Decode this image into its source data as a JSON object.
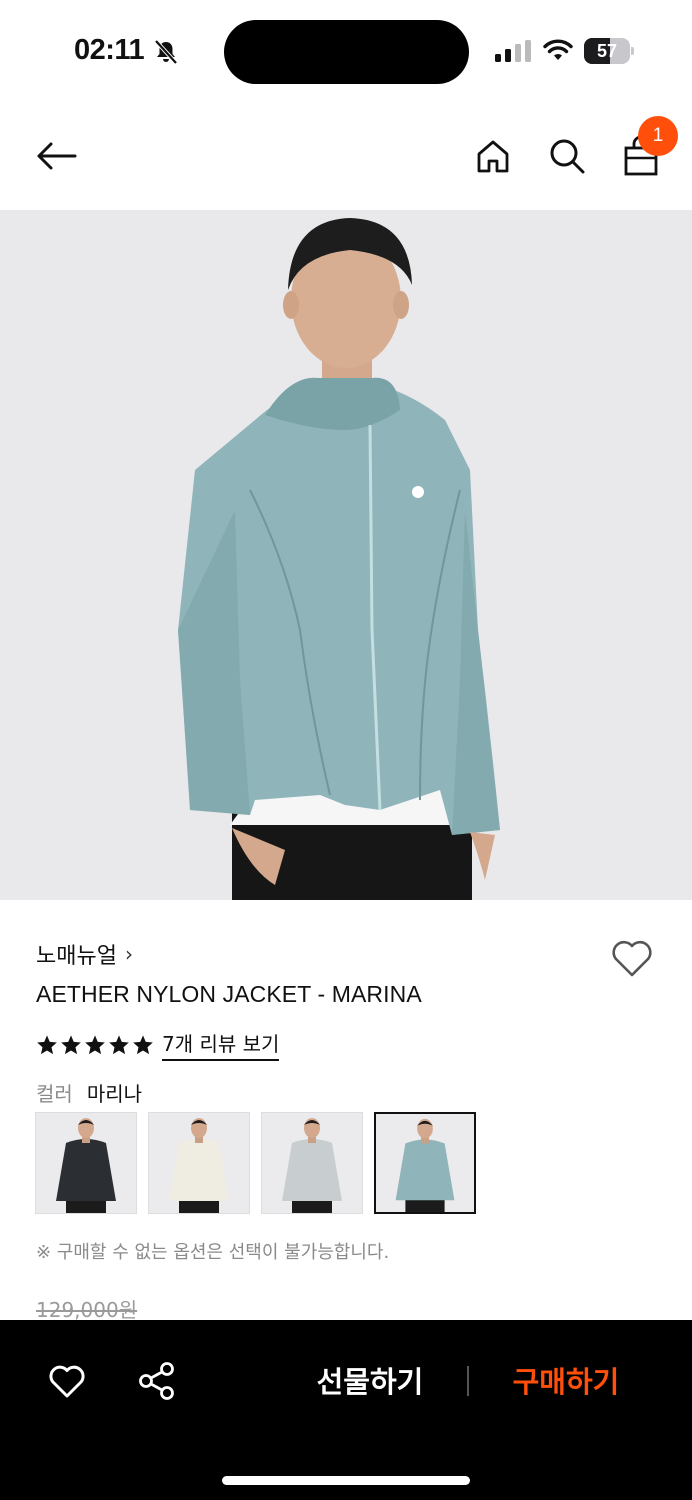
{
  "status_bar": {
    "time": "02:11",
    "battery_percent": "57",
    "battery_level": 0.57,
    "icons": [
      "bell-slash-icon",
      "cellular-signal-icon",
      "wifi-icon",
      "battery-icon"
    ]
  },
  "nav": {
    "icons": [
      "back-arrow-icon",
      "home-icon",
      "search-icon",
      "shopping-bag-icon"
    ],
    "cart_count": "1"
  },
  "product": {
    "brand": "노매뉴얼",
    "brand_chevron": "›",
    "name": "AETHER NYLON JACKET - MARINA",
    "rating_stars": 5,
    "review_link": "7개 리뷰 보기",
    "color_label": "컬러",
    "color_value": "마리나",
    "swatches": [
      {
        "name": "black",
        "color": "#2b2f33"
      },
      {
        "name": "cream",
        "color": "#efece2"
      },
      {
        "name": "grey",
        "color": "#c8cdd0"
      },
      {
        "name": "marina",
        "color": "#8fb5ba",
        "selected": true
      }
    ],
    "notice": "※ 구매할 수 없는 옵션은 선택이 불가능합니다.",
    "original_price": "129,000원"
  },
  "bottom_bar": {
    "gift_label": "선물하기",
    "buy_label": "구매하기",
    "icons": [
      "heart-icon",
      "share-icon"
    ]
  },
  "colors": {
    "accent": "#ff4f0b",
    "jacket": "#8fb5ba",
    "background_image": "#e9e9eb"
  }
}
